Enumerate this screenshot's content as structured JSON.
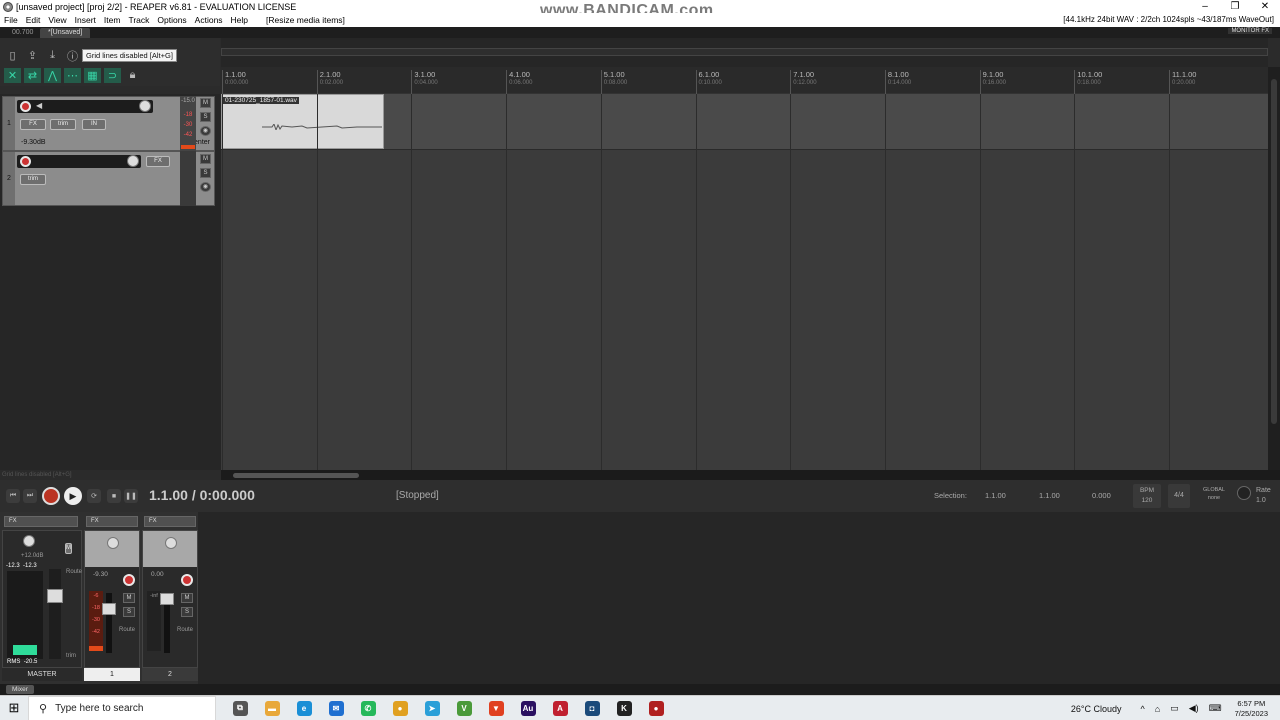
{
  "window": {
    "title": "[unsaved project] [proj 2/2] - REAPER v6.81 - EVALUATION LICENSE",
    "watermark": "www.BANDICAM.com",
    "controls": {
      "minimize": "–",
      "maximize": "❐",
      "close": "✕"
    }
  },
  "menu": {
    "items": [
      "File",
      "Edit",
      "View",
      "Insert",
      "Item",
      "Track",
      "Options",
      "Actions",
      "Help"
    ],
    "resize_label": "[Resize media items]",
    "audio_status": "[44.1kHz 24bit WAV : 2/2ch 1024spls ~43/187ms WaveOut]"
  },
  "tabs": {
    "time_small": "00.700",
    "project_tab": "*[Unsaved]",
    "monitor_fx": "MONITOR FX"
  },
  "tooltip": "Grid lines disabled [Alt+G]",
  "ruler": {
    "marks": [
      {
        "bar": "1.1.00",
        "time": "0:00.000"
      },
      {
        "bar": "2.1.00",
        "time": "0:02.000"
      },
      {
        "bar": "3.1.00",
        "time": "0:04.000"
      },
      {
        "bar": "4.1.00",
        "time": "0:06.000"
      },
      {
        "bar": "5.1.00",
        "time": "0:08.000"
      },
      {
        "bar": "6.1.00",
        "time": "0:10.000"
      },
      {
        "bar": "7.1.00",
        "time": "0:12.000"
      },
      {
        "bar": "8.1.00",
        "time": "0:14.000"
      },
      {
        "bar": "9.1.00",
        "time": "0:16.000"
      },
      {
        "bar": "10.1.00",
        "time": "0:18.000"
      },
      {
        "bar": "11.1.00",
        "time": "0:20.000"
      }
    ]
  },
  "tracks": [
    {
      "number": "1",
      "volume": "-9.30dB",
      "pan": "center",
      "fx": "FX",
      "trim": "trim",
      "in": "IN",
      "levels": [
        "-15.0",
        "-18",
        "-30",
        "-42"
      ]
    },
    {
      "number": "2",
      "fx": "FX",
      "trim": "trim"
    }
  ],
  "item": {
    "name": "01-230725_1857-01.wav"
  },
  "status_left": "Grid lines disabled [Alt+G]",
  "transport": {
    "time": "1.1.00 / 0:00.000",
    "state": "[Stopped]",
    "selection_label": "Selection:",
    "selection_start": "1.1.00",
    "selection_end": "1.1.00",
    "selection_length": "0.000",
    "bpm_label": "BPM",
    "bpm": "120",
    "time_sig": "4/4",
    "global_label": "GLOBAL",
    "global_value": "none",
    "rate_label": "Rate",
    "rate": "1.0"
  },
  "mixer": {
    "fx_label": "FX",
    "master": {
      "label": "MASTER",
      "vol": "+12.0dB",
      "peak_l": "-12.3",
      "peak_r": "-12.3",
      "rms_label": "RMS",
      "rms_value": "-20.5",
      "trim": "trim",
      "route": "Route"
    },
    "strips": [
      {
        "label": "1",
        "vol": "-9.30",
        "route": "Route",
        "levels": [
          "-15.0",
          "-6",
          "-18",
          "-30",
          "-42"
        ]
      },
      {
        "label": "2",
        "vol": "0.00",
        "route": "Route",
        "levels": [
          "-inf"
        ]
      }
    ],
    "tab": "Mixer"
  },
  "taskbar": {
    "search_placeholder": "Type here to search",
    "apps": [
      {
        "name": "task-view",
        "color": "#555555",
        "glyph": "⧉"
      },
      {
        "name": "file-explorer",
        "color": "#e8a83a",
        "glyph": "▬"
      },
      {
        "name": "edge",
        "color": "#1a8fd6",
        "glyph": "e"
      },
      {
        "name": "mail",
        "color": "#1f6fd0",
        "glyph": "✉"
      },
      {
        "name": "whatsapp",
        "color": "#25b85a",
        "glyph": "✆"
      },
      {
        "name": "chrome",
        "color": "#e0a020",
        "glyph": "●"
      },
      {
        "name": "telegram",
        "color": "#2a9fd8",
        "glyph": "➤"
      },
      {
        "name": "vivaldi",
        "color": "#4a9a3a",
        "glyph": "V"
      },
      {
        "name": "brave",
        "color": "#e04020",
        "glyph": "▼"
      },
      {
        "name": "audition",
        "color": "#2a1060",
        "glyph": "Au"
      },
      {
        "name": "affinity",
        "color": "#c02030",
        "glyph": "A"
      },
      {
        "name": "capture",
        "color": "#1a4a7a",
        "glyph": "◘"
      },
      {
        "name": "k-app",
        "color": "#222222",
        "glyph": "K"
      },
      {
        "name": "bandicam",
        "color": "#b02020",
        "glyph": "●"
      }
    ],
    "weather": "26°C  Cloudy",
    "time": "6:57 PM",
    "date": "7/25/2023"
  },
  "colors": {
    "accent": "#38d6a8",
    "record": "#cc3333",
    "meter_green": "#2fdc9a"
  }
}
